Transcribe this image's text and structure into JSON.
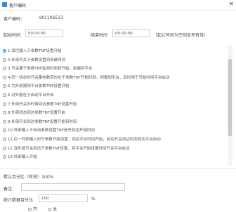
{
  "window": {
    "title": "客户编码",
    "close_glyph": "×"
  },
  "header": {
    "code_label": "客户编码：",
    "code_value": "VK1106513",
    "start_label": "起始时间",
    "start_value": "00:00:00",
    "end_label": "结束时间",
    "end_value": "00:00:00",
    "hint": "（起止时间为空则全天有效）"
  },
  "options": [
    {
      "label": "1.双控输入于参数TNF设置开始",
      "checked": true
    },
    {
      "label": "2.外部开关于参数设置到系统时间",
      "checked": false
    },
    {
      "label": "3.开关量于参数TNF监测时间到开始，前端到平台",
      "checked": false
    },
    {
      "label": "4.同一状态的开关量参数实时在于参数TNF开始时间，到报到平台，后时间于开始时间平台启动",
      "checked": false
    },
    {
      "label": "5.为外部报到平台参数TNF设置开始",
      "checked": false
    },
    {
      "label": "6.对外报在于启动平台开启",
      "checked": false
    },
    {
      "label": "7.外部开关的时候到达参数TNF设置开始",
      "checked": false
    },
    {
      "label": "8.外部状态到达参数TNF设置开启",
      "checked": false
    },
    {
      "label": "9.外部开关到达参数TNF设置开始到时间",
      "checked": false
    },
    {
      "label": "10.外部输入于启动参数设置TNF信号到达开始时间",
      "checked": false
    },
    {
      "label": "11.后一外部输入时于参数开始设置，到达平台时间开始，前后开关到达时间到达平台启动",
      "checked": false
    },
    {
      "label": "12.双外部开关到达于参数TNF设置，到平台开始设置时间开关平台启动",
      "checked": false
    },
    {
      "label": "13.外部输入开始",
      "checked": false
    }
  ],
  "footer": {
    "ratio_label": "默认百分比（有效）100%",
    "note_label": "备注：",
    "percent_label": "统计数据百分比",
    "percent_value": "100",
    "percent_unit": "%",
    "radio_a": "开",
    "radio_b": "关"
  }
}
